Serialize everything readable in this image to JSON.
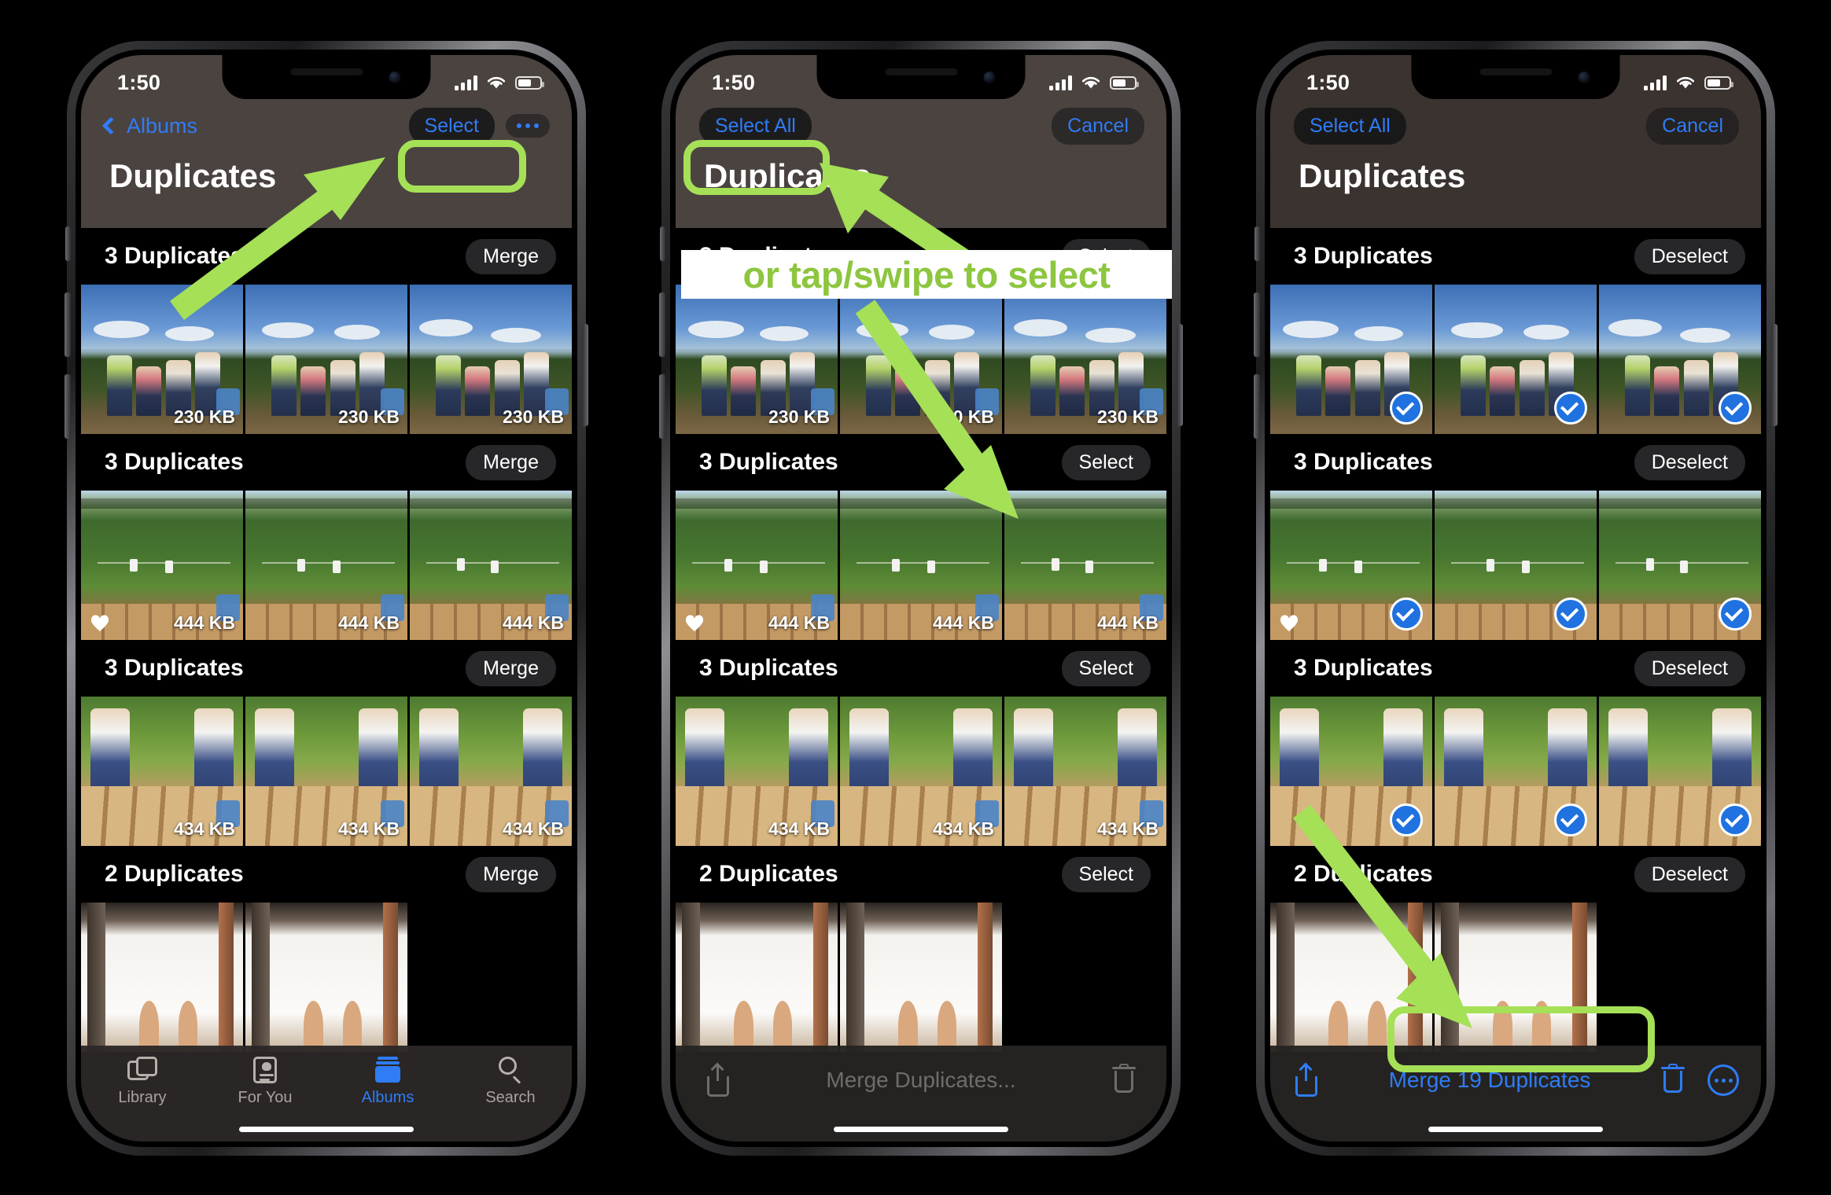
{
  "accent": {
    "ios_blue": "#2f7cf6",
    "highlight_green": "#a5e057",
    "banner_text_green": "#8dc63f",
    "check_blue": "#1f72e0"
  },
  "status_bar": {
    "time": "1:50",
    "cellular": "signal-bars-icon",
    "wifi": "wifi-icon",
    "battery": "battery-icon"
  },
  "phones": [
    {
      "id": "phone-browse",
      "nav": {
        "back_label": "Albums",
        "action_label": "Select",
        "more_label": "more-options",
        "title": "Duplicates"
      },
      "groups": [
        {
          "title": "3 Duplicates",
          "button": "Merge",
          "size": "230 KB",
          "count": 3,
          "scene": "a",
          "favorite": false,
          "selected": false
        },
        {
          "title": "3 Duplicates",
          "button": "Merge",
          "size": "444 KB",
          "count": 3,
          "scene": "b",
          "favorite": true,
          "selected": false
        },
        {
          "title": "3 Duplicates",
          "button": "Merge",
          "size": "434 KB",
          "count": 3,
          "scene": "c",
          "favorite": false,
          "selected": false
        },
        {
          "title": "2 Duplicates",
          "button": "Merge",
          "size": "",
          "count": 2,
          "scene": "d",
          "favorite": false,
          "selected": false
        }
      ],
      "tabbar": [
        {
          "label": "Library",
          "icon": "library-icon",
          "active": false
        },
        {
          "label": "For You",
          "icon": "for-you-icon",
          "active": false
        },
        {
          "label": "Albums",
          "icon": "albums-icon",
          "active": true
        },
        {
          "label": "Search",
          "icon": "search-icon",
          "active": false
        }
      ],
      "annotation": {
        "highlight": "Select button",
        "arrow": "points up-right to Select"
      }
    },
    {
      "id": "phone-select-mode",
      "nav": {
        "select_all_label": "Select All",
        "cancel_label": "Cancel",
        "title": "Duplicates"
      },
      "banner_text": "or tap/swipe to select",
      "groups": [
        {
          "title": "3 Duplicates",
          "button": "Select",
          "size": "230 KB",
          "count": 3,
          "scene": "a",
          "favorite": false,
          "selected": false
        },
        {
          "title": "3 Duplicates",
          "button": "Select",
          "size": "444 KB",
          "count": 3,
          "scene": "b",
          "favorite": true,
          "selected": false
        },
        {
          "title": "3 Duplicates",
          "button": "Select",
          "size": "434 KB",
          "count": 3,
          "scene": "c",
          "favorite": false,
          "selected": false
        },
        {
          "title": "2 Duplicates",
          "button": "Select",
          "size": "",
          "count": 2,
          "scene": "d",
          "favorite": false,
          "selected": false
        }
      ],
      "toolbar": {
        "share_label": "share-icon",
        "center_label": "Merge Duplicates...",
        "center_disabled": true,
        "trash_label": "trash-icon"
      },
      "annotation": {
        "highlight": "Select All button",
        "arrows": "two green arrows to Select All and to a photo row"
      }
    },
    {
      "id": "phone-all-selected",
      "nav": {
        "select_all_label": "Select All",
        "cancel_label": "Cancel",
        "title": "Duplicates"
      },
      "groups": [
        {
          "title": "3 Duplicates",
          "button": "Deselect",
          "size": "230 KB",
          "count": 3,
          "scene": "a",
          "favorite": false,
          "selected": true
        },
        {
          "title": "3 Duplicates",
          "button": "Deselect",
          "size": "444 KB",
          "count": 3,
          "scene": "b",
          "favorite": true,
          "selected": true
        },
        {
          "title": "3 Duplicates",
          "button": "Deselect",
          "size": "434 KB",
          "count": 3,
          "scene": "c",
          "favorite": false,
          "selected": true
        },
        {
          "title": "2 Duplicates",
          "button": "Deselect",
          "size": "",
          "count": 2,
          "scene": "d",
          "favorite": false,
          "selected": false
        }
      ],
      "toolbar": {
        "share_label": "share-icon",
        "center_label": "Merge 19 Duplicates",
        "center_disabled": false,
        "trash_label": "trash-icon",
        "more_label": "more-circle-icon"
      },
      "annotation": {
        "highlight": "Merge 19 Duplicates button",
        "arrow": "points down-right to Merge 19 Duplicates"
      }
    }
  ]
}
